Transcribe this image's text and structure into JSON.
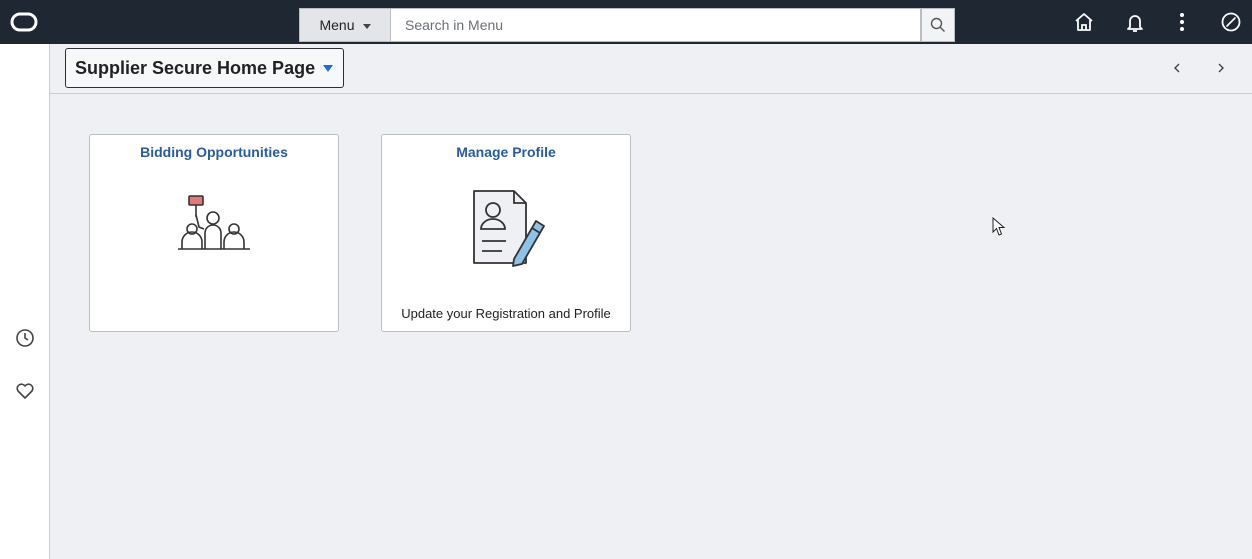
{
  "topbar": {
    "menu_label": "Menu",
    "search_placeholder": "Search in Menu",
    "icons": [
      "logo-icon",
      "search-icon",
      "home-icon",
      "bell-icon",
      "more-vertical-icon",
      "navbar-compass-icon"
    ]
  },
  "rail": {
    "icons": [
      "recents-clock-icon",
      "favorites-heart-icon"
    ]
  },
  "header": {
    "title": "Supplier Secure Home Page"
  },
  "tiles": [
    {
      "title": "Bidding Opportunities",
      "subtitle": "",
      "icon": "bidding-auction-icon"
    },
    {
      "title": "Manage Profile",
      "subtitle": "Update your Registration and Profile",
      "icon": "profile-document-pencil-icon"
    }
  ],
  "colors": {
    "topbar": "#1f2733",
    "link_blue": "#2a5b9b",
    "caret_blue": "#1f6ed4",
    "background": "#eef0f4"
  }
}
